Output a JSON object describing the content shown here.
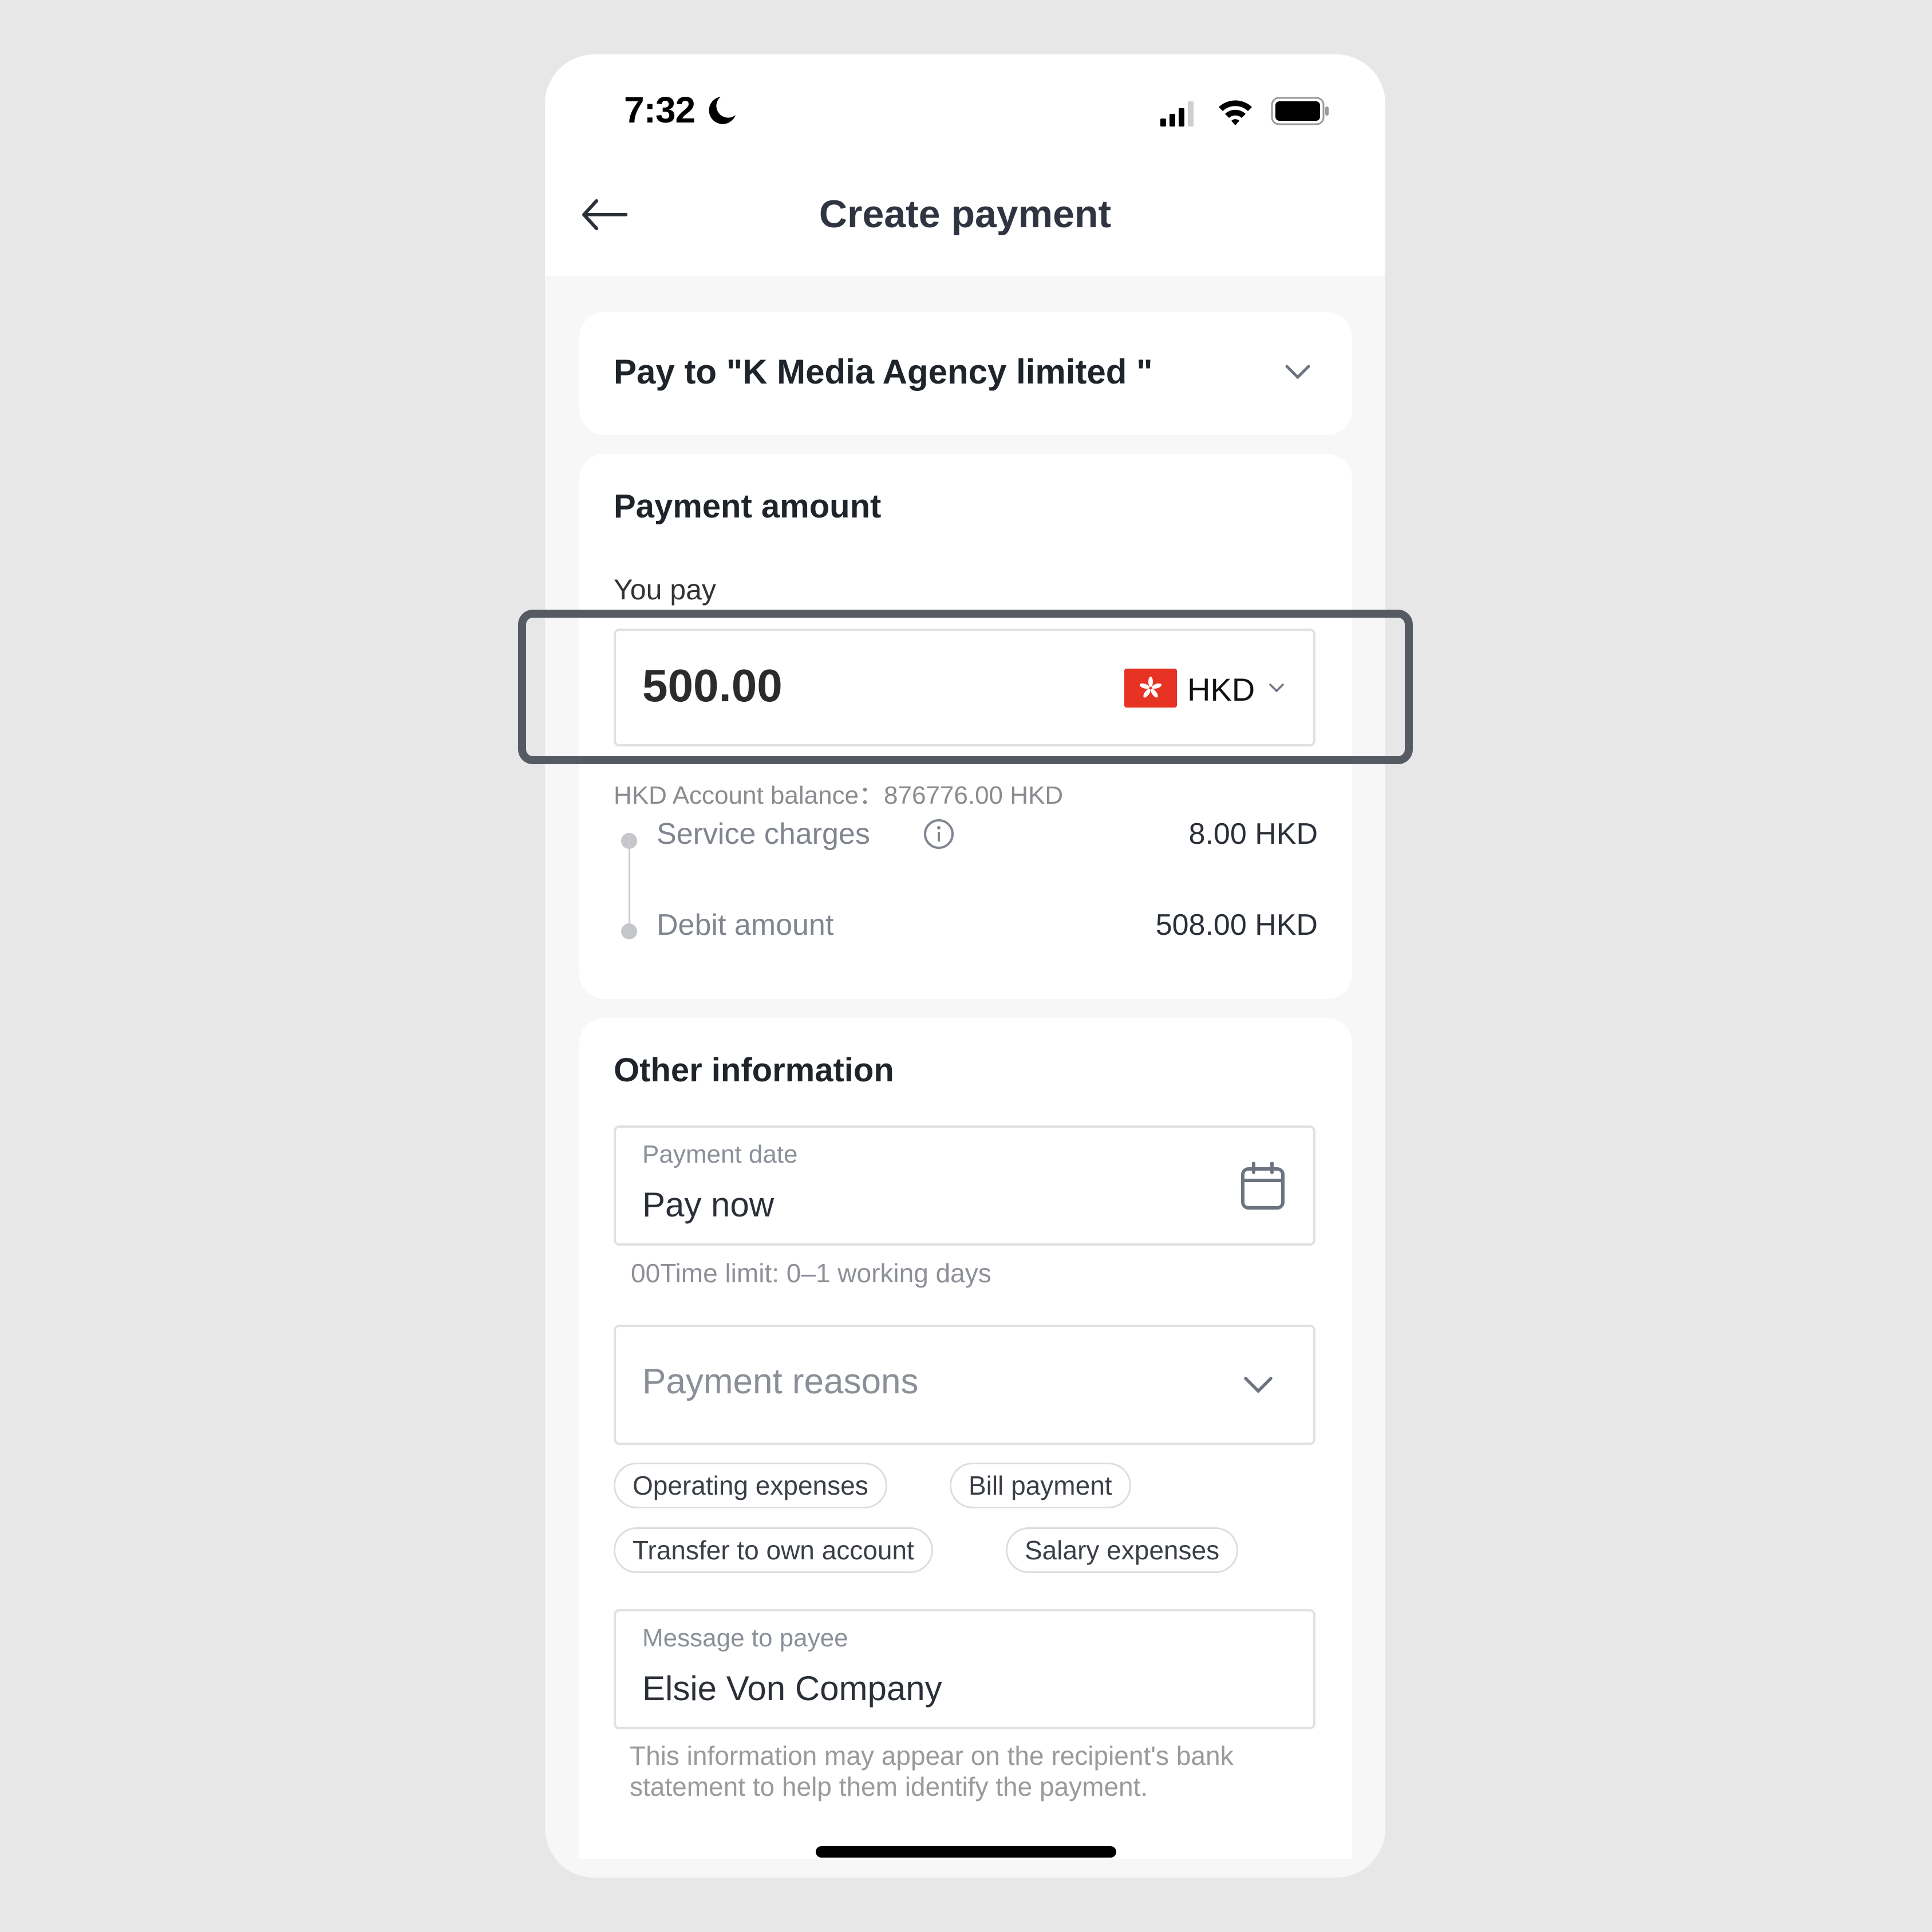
{
  "status_bar": {
    "time": "7:32",
    "icons": [
      "moon-icon",
      "signal-icon",
      "wifi-icon",
      "battery-icon"
    ]
  },
  "header": {
    "title": "Create payment",
    "back_icon": "arrow-left-icon"
  },
  "payee": {
    "label": "Pay to \"K Media Agency limited \"",
    "icon": "chevron-down-icon"
  },
  "payment_amount": {
    "section_title": "Payment amount",
    "you_pay_label": "You pay",
    "amount_value": "500.00",
    "currency": "HKD",
    "currency_flag": "hong-kong-flag-icon",
    "balance_text": "HKD Account balance：876776.00 HKD",
    "service_charges_label": "Service charges",
    "service_charges_value": "8.00 HKD",
    "debit_amount_label": "Debit amount",
    "debit_amount_value": "508.00 HKD"
  },
  "other_information": {
    "section_title": "Other information",
    "payment_date": {
      "label": "Payment date",
      "value": "Pay now",
      "icon": "calendar-icon"
    },
    "time_limit_hint": "00Time limit: 0–1 working days",
    "payment_reasons": {
      "placeholder": "Payment reasons",
      "icon": "chevron-down-icon"
    },
    "reason_chips": [
      "Operating expenses",
      "Bill payment",
      "Transfer to own account",
      "Salary expenses"
    ],
    "message_to_payee": {
      "label": "Message to payee",
      "value": "Elsie Von Company"
    },
    "message_hint": "This information may appear on the recipient's bank statement to help them identify the payment."
  },
  "colors": {
    "highlight_border": "#555a63",
    "flag_red": "#e63323",
    "page_bg": "#f7f7f7"
  }
}
